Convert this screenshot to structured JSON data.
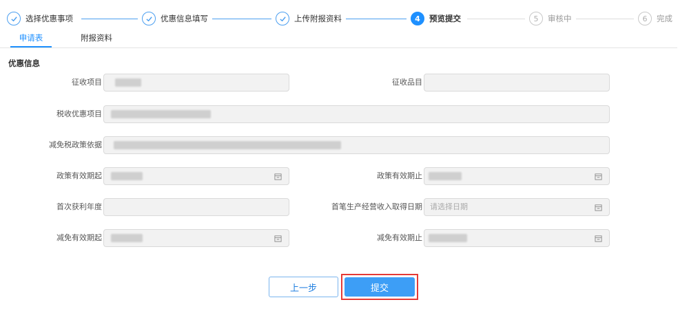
{
  "steps": [
    {
      "num": "",
      "label": "选择优惠事项",
      "state": "done"
    },
    {
      "num": "",
      "label": "优惠信息填写",
      "state": "done"
    },
    {
      "num": "",
      "label": "上传附报资料",
      "state": "done"
    },
    {
      "num": "4",
      "label": "预览提交",
      "state": "active"
    },
    {
      "num": "5",
      "label": "审核中",
      "state": "pending"
    },
    {
      "num": "6",
      "label": "完成",
      "state": "pending"
    }
  ],
  "tabs": [
    {
      "label": "申请表",
      "active": true
    },
    {
      "label": "附报资料",
      "active": false
    }
  ],
  "section_title": "优惠信息",
  "fields": {
    "levy_item": {
      "label": "征收项目",
      "value": ""
    },
    "levy_product": {
      "label": "征收品目",
      "value": ""
    },
    "tax_preference_item": {
      "label": "税收优惠项目",
      "value": ""
    },
    "reduction_policy_basis": {
      "label": "减免税政策依据",
      "value": ""
    },
    "policy_valid_from": {
      "label": "政策有效期起",
      "value": ""
    },
    "policy_valid_to": {
      "label": "政策有效期止",
      "value": ""
    },
    "first_profit_year": {
      "label": "首次获利年度",
      "value": ""
    },
    "first_revenue_date": {
      "label": "首笔生产经营收入取得日期",
      "placeholder": "请选择日期"
    },
    "reduction_valid_from": {
      "label": "减免有效期起",
      "value": ""
    },
    "reduction_valid_to": {
      "label": "减免有效期止",
      "value": ""
    }
  },
  "buttons": {
    "prev": "上一步",
    "submit": "提交"
  },
  "colors": {
    "accent": "#1e90ff",
    "submit_bg": "#3d9ef6",
    "highlight_border": "#e53935"
  }
}
